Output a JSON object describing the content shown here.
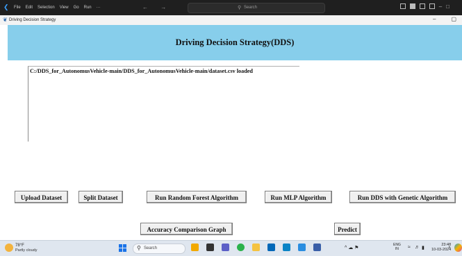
{
  "editor_bar": {
    "menu": [
      "File",
      "Edit",
      "Selection",
      "View",
      "Go",
      "Run",
      "···"
    ],
    "nav_arrows": "← →",
    "search_placeholder": "Search",
    "window_controls": [
      "–",
      "□"
    ]
  },
  "app": {
    "window_title": "Driving Decision Strategy",
    "header_title": "Driving Decision Strategy(DDS)",
    "output_text": "C:/DDS_for_AutonomusVehicle-main/DDS_for_AutonomusVehicle-main/dataset.csv loaded",
    "window_controls": [
      "–",
      "▢"
    ],
    "buttons": {
      "upload": "Upload Dataset",
      "split": "Split Dataset",
      "random_forest": "Run Random Forest Algorithm",
      "mlp": "Run MLP Algorithm",
      "dds_genetic": "Run DDS with Genetic Algorithm",
      "accuracy_graph": "Accuracy Comparison Graph",
      "predict": "Predict"
    },
    "header_color": "#87ceeb"
  },
  "taskbar": {
    "weather_temp": "78°F",
    "weather_condition": "Partly cloudy",
    "search_label": "Search",
    "language_line1": "ENG",
    "language_line2": "IN",
    "time": "23:48",
    "date": "10-03-2024",
    "tray_glyphs": "^ ☁ ⚑"
  }
}
